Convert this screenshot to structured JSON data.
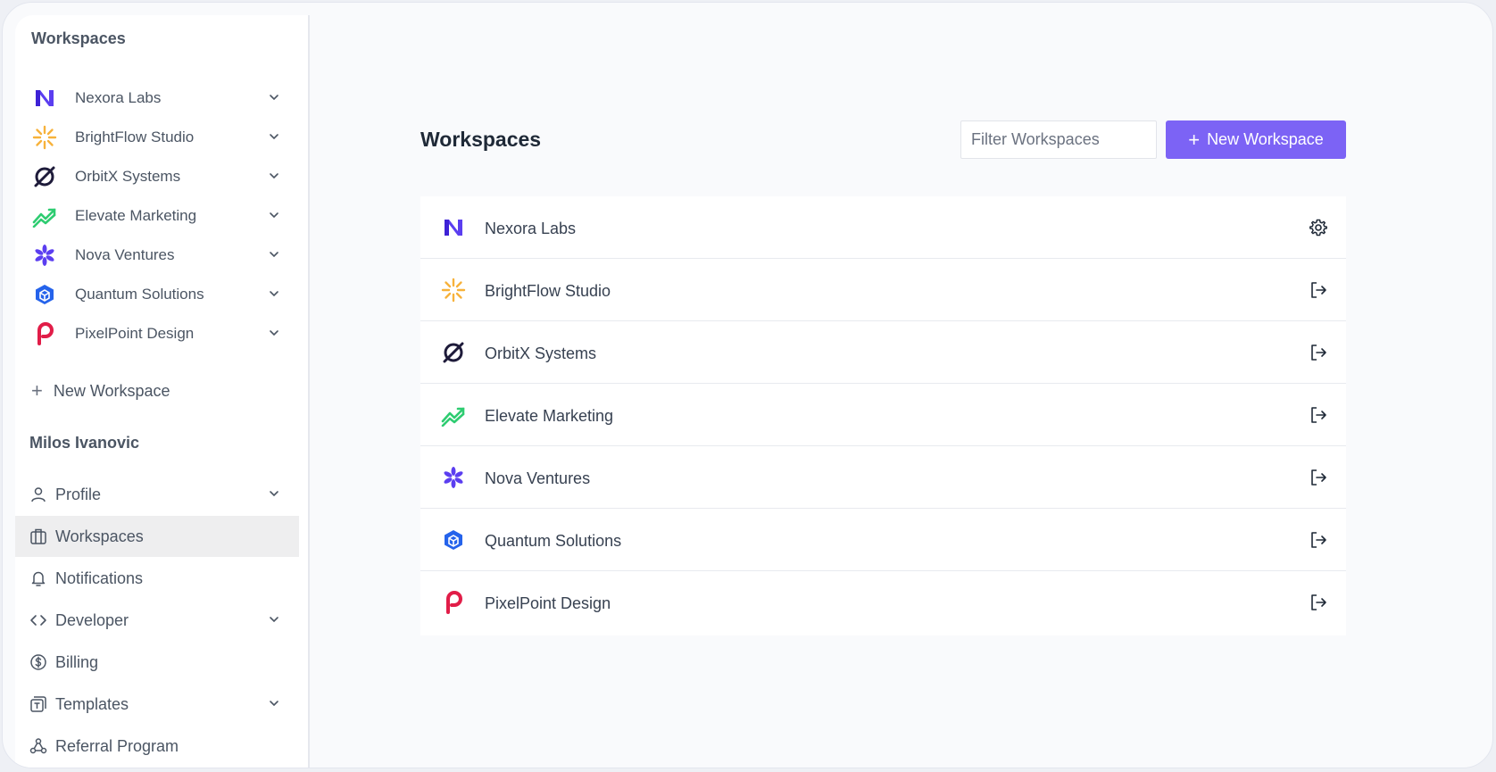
{
  "sidebar": {
    "title": "Workspaces",
    "workspaces": [
      {
        "label": "Nexora Labs",
        "icon": "nexora-logo-icon",
        "color": "#5b3ef0"
      },
      {
        "label": "BrightFlow Studio",
        "icon": "brightflow-logo-icon",
        "color": "#f7b23b"
      },
      {
        "label": "OrbitX Systems",
        "icon": "orbitx-logo-icon",
        "color": "#1e1b3a"
      },
      {
        "label": "Elevate Marketing",
        "icon": "elevate-logo-icon",
        "color": "#2ecc71"
      },
      {
        "label": "Nova Ventures",
        "icon": "nova-logo-icon",
        "color": "#5b3ef0"
      },
      {
        "label": "Quantum Solutions",
        "icon": "quantum-logo-icon",
        "color": "#2563eb"
      },
      {
        "label": "PixelPoint Design",
        "icon": "pixelpoint-logo-icon",
        "color": "#e11d48"
      }
    ],
    "new_workspace_label": "New Workspace",
    "user_name": "Milos Ivanovic",
    "nav": [
      {
        "label": "Profile",
        "icon": "user-icon",
        "expandable": true
      },
      {
        "label": "Workspaces",
        "icon": "briefcase-icon",
        "expandable": false,
        "active": true
      },
      {
        "label": "Notifications",
        "icon": "bell-icon",
        "expandable": false
      },
      {
        "label": "Developer",
        "icon": "code-icon",
        "expandable": true
      },
      {
        "label": "Billing",
        "icon": "dollar-icon",
        "expandable": false
      },
      {
        "label": "Templates",
        "icon": "template-icon",
        "expandable": true
      },
      {
        "label": "Referral Program",
        "icon": "referral-icon",
        "expandable": false
      }
    ]
  },
  "main": {
    "title": "Workspaces",
    "filter_placeholder": "Filter Workspaces",
    "new_button_label": "New Workspace",
    "rows": [
      {
        "label": "Nexora Labs",
        "action": "settings"
      },
      {
        "label": "BrightFlow Studio",
        "action": "leave"
      },
      {
        "label": "OrbitX Systems",
        "action": "leave"
      },
      {
        "label": "Elevate Marketing",
        "action": "leave"
      },
      {
        "label": "Nova Ventures",
        "action": "leave"
      },
      {
        "label": "Quantum Solutions",
        "action": "leave"
      },
      {
        "label": "PixelPoint Design",
        "action": "leave"
      }
    ]
  },
  "colors": {
    "accent": "#7c63f5",
    "active_bg": "#eeeeef",
    "text_muted": "#4b5563"
  }
}
